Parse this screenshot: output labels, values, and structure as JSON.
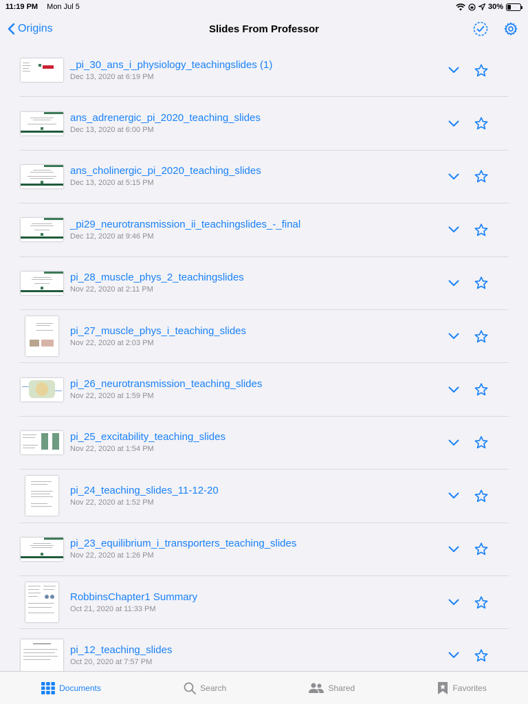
{
  "status_bar": {
    "time": "11:19 PM",
    "date": "Mon Jul 5",
    "battery": "30%",
    "battery_level": 0.3,
    "icons": [
      "wifi-icon",
      "orientation-lock-icon",
      "location-icon",
      "battery-icon"
    ]
  },
  "nav": {
    "back_label": "Origins",
    "title": "Slides From Professor",
    "actions": [
      "select-icon",
      "gear-icon"
    ]
  },
  "files": [
    {
      "name": "_pi_30_ans_i_physiology_teachingslides (1)",
      "date": "Dec 13, 2020 at 6:19 PM"
    },
    {
      "name": "ans_adrenergic_pi_2020_teaching_slides",
      "date": "Dec 13, 2020 at 6:00 PM"
    },
    {
      "name": "ans_cholinergic_pi_2020_teaching_slides",
      "date": "Dec 13, 2020 at 5:15 PM"
    },
    {
      "name": "_pi29_neurotransmission_ii_teachingslides_-_final",
      "date": "Dec 12, 2020 at 9:46 PM"
    },
    {
      "name": "pi_28_muscle_phys_2_teachingslides",
      "date": "Nov 22, 2020 at 2:11 PM"
    },
    {
      "name": "pi_27_muscle_phys_i_teaching_slides",
      "date": "Nov 22, 2020 at 2:03 PM"
    },
    {
      "name": "pi_26_neurotransmission_teaching_slides",
      "date": "Nov 22, 2020 at 1:59 PM"
    },
    {
      "name": "pi_25_excitability_teaching_slides",
      "date": "Nov 22, 2020 at 1:54 PM"
    },
    {
      "name": "pi_24_teaching_slides_11-12-20",
      "date": "Nov 22, 2020 at 1:52 PM"
    },
    {
      "name": "pi_23_equilibrium_i_transporters_teaching_slides",
      "date": "Nov 22, 2020 at 1:26 PM"
    },
    {
      "name": "RobbinsChapter1 Summary",
      "date": "Oct 21, 2020 at 11:33 PM"
    },
    {
      "name": "pi_12_teaching_slides",
      "date": "Oct 20, 2020 at 7:57 PM"
    }
  ],
  "tabs": [
    {
      "label": "Documents",
      "icon": "grid-icon"
    },
    {
      "label": "Search",
      "icon": "search-icon"
    },
    {
      "label": "Shared",
      "icon": "people-icon"
    },
    {
      "label": "Favorites",
      "icon": "bookmark-star-icon"
    }
  ],
  "colors": {
    "accent": "#1a82f7",
    "secondary_text": "#8e8e93",
    "background": "#f2f2f7"
  }
}
